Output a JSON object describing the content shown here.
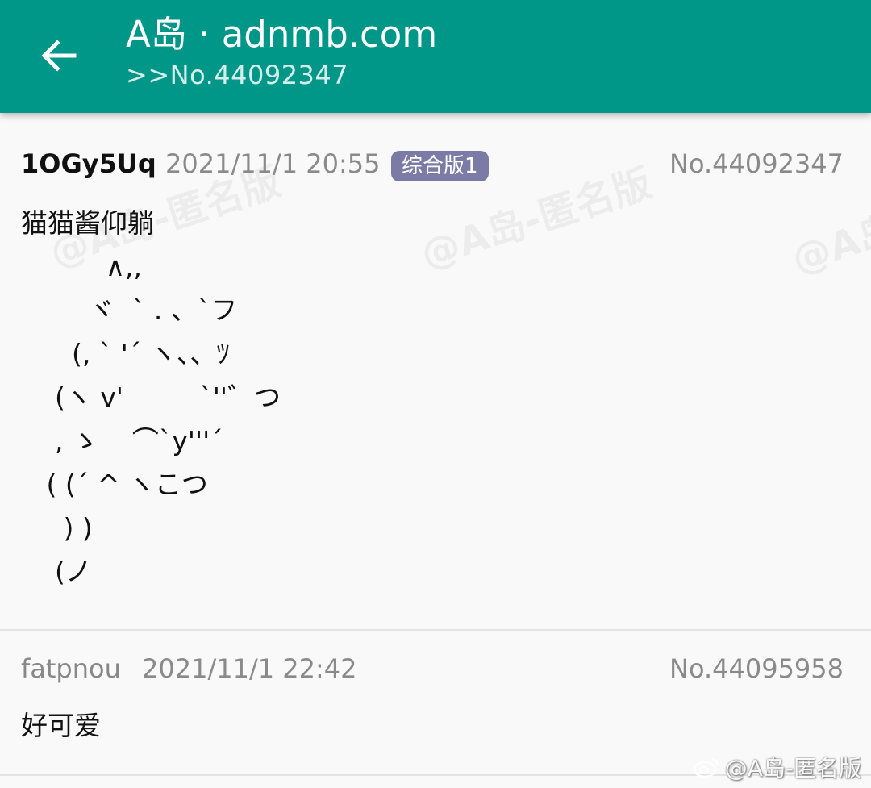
{
  "appbar": {
    "title": "A岛 · adnmb.com",
    "subtitle": ">>No.44092347"
  },
  "posts": [
    {
      "uid": "1OGy5Uq",
      "time": "2021/11/1 20:55",
      "board": "综合版1",
      "number": "No.44092347",
      "content": "猫猫酱仰躺\n          ∧,,\n        ヾ  ` . 、`フ\n      (, ` '´ ヽ、、ﾂ\n    (ヽ v'         `''゛つ\n    , ゝ    ⌒`y'''´\n   ( (´ ^ ヽこつ\n     ) )\n    (ノ"
    },
    {
      "uid": "fatpnou",
      "time": "2021/11/1 22:42",
      "number": "No.44095958",
      "content": "好可爱"
    }
  ],
  "watermark": {
    "text": "@A岛-匿名版",
    "weibo": "@A岛-匿名版"
  },
  "colors": {
    "appbar": "#009688",
    "badge": "#7c7ba6",
    "background": "#f9f9f9"
  },
  "icons": {
    "back": "arrow-left-icon",
    "weibo": "weibo-icon"
  }
}
